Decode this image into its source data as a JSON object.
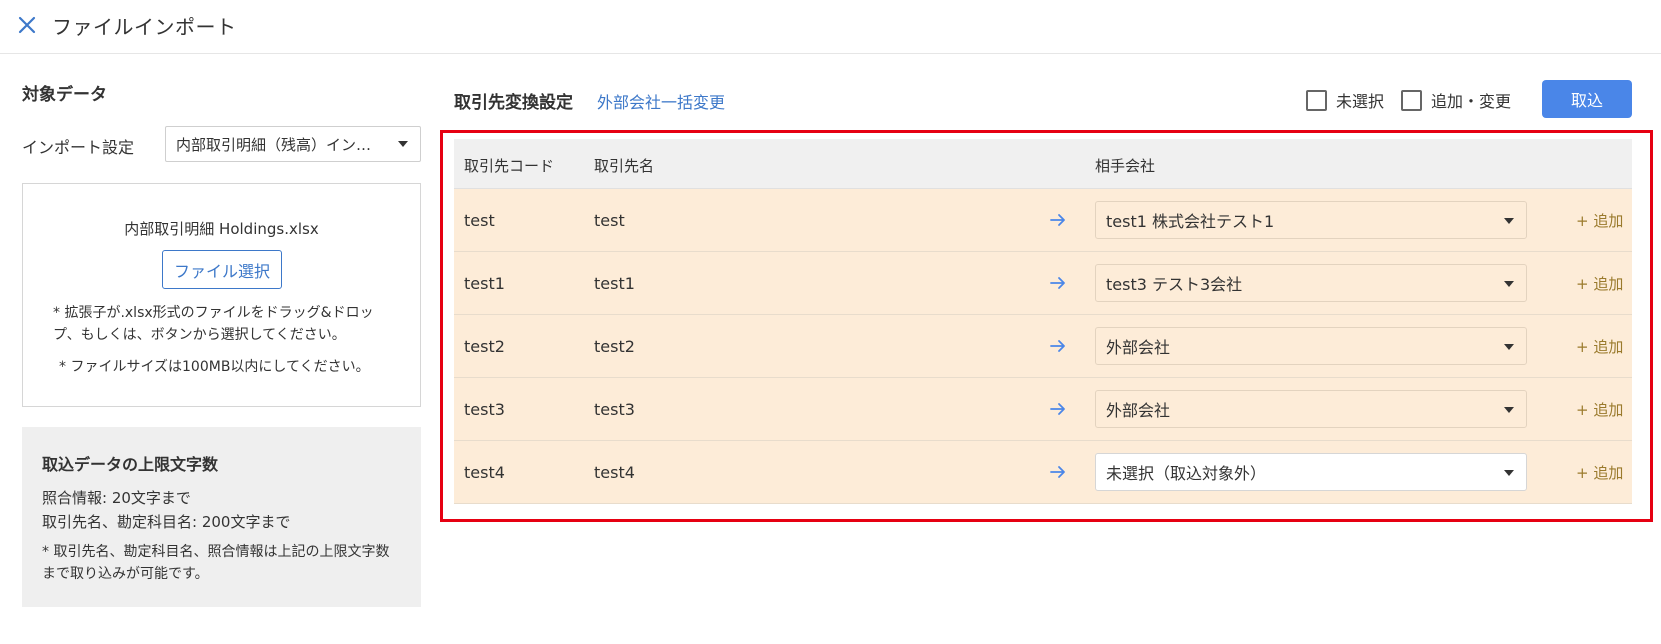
{
  "header": {
    "title": "ファイルインポート",
    "close_icon": "close-icon"
  },
  "left": {
    "title": "対象データ",
    "import_setting_label": "インポート設定",
    "import_setting_value": "内部取引明細（残高）イン…",
    "upload": {
      "file_name": "内部取引明細 Holdings.xlsx",
      "file_button": "ファイル選択",
      "note1": "* 拡張子が.xlsx形式のファイルをドラッグ&ドロップ、もしくは、ボタンから選択してください。",
      "note2": "* ファイルサイズは100MB以内にしてください。"
    },
    "limit": {
      "title": "取込データの上限文字数",
      "line1": "照合情報: 20文字まで",
      "line2": "取引先名、勘定科目名: 200文字まで",
      "note": "* 取引先名、勘定科目名、照合情報は上記の上限文字数まで取り込みが可能です。"
    }
  },
  "main": {
    "section_title": "取引先変換設定",
    "bulk_link": "外部会社一括変更",
    "checkbox_unselected": "未選択",
    "checkbox_add_change": "追加・変更",
    "import_button": "取込",
    "columns": {
      "code": "取引先コード",
      "name": "取引先名",
      "partner": "相手会社"
    },
    "rows": [
      {
        "code": "test",
        "name": "test",
        "partner": "test1 株式会社テスト1",
        "add": "+ 追加"
      },
      {
        "code": "test1",
        "name": "test1",
        "partner": "test3 テスト3会社",
        "add": "+ 追加"
      },
      {
        "code": "test2",
        "name": "test2",
        "partner": "外部会社",
        "add": "+ 追加"
      },
      {
        "code": "test3",
        "name": "test3",
        "partner": "外部会社",
        "add": "+ 追加"
      },
      {
        "code": "test4",
        "name": "test4",
        "partner": "未選択（取込対象外）",
        "add": "+ 追加"
      }
    ]
  },
  "colors": {
    "accent": "#4a86e8",
    "link": "#3d78c9",
    "row_bg": "#fdecd8",
    "highlight_frame": "#e60012",
    "add_link": "#9a7a2c"
  }
}
